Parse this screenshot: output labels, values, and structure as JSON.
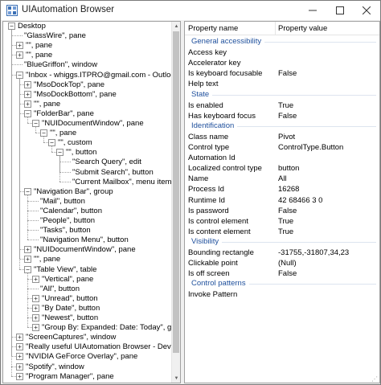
{
  "window": {
    "title": "UIAutomation Browser",
    "icon": "app-grid-icon"
  },
  "window_buttons": {
    "minimize": "minimize-icon",
    "maximize": "maximize-icon",
    "close": "close-icon"
  },
  "tree": {
    "nodes": [
      {
        "label": "Desktop",
        "depth": 0,
        "expander": "minus"
      },
      {
        "label": "\"GlassWire\", pane",
        "depth": 1,
        "expander": "none"
      },
      {
        "label": "\"\", pane",
        "depth": 1,
        "expander": "plus"
      },
      {
        "label": "\"\", pane",
        "depth": 1,
        "expander": "plus"
      },
      {
        "label": "\"BlueGriffon\", window",
        "depth": 1,
        "expander": "none"
      },
      {
        "label": "\"Inbox - whiggs.ITPRO@gmail.com - Outlook\", window",
        "depth": 1,
        "expander": "minus"
      },
      {
        "label": "\"MsoDockTop\", pane",
        "depth": 2,
        "expander": "plus"
      },
      {
        "label": "\"MsoDockBottom\", pane",
        "depth": 2,
        "expander": "plus"
      },
      {
        "label": "\"\", pane",
        "depth": 2,
        "expander": "plus"
      },
      {
        "label": "\"FolderBar\", pane",
        "depth": 2,
        "expander": "minus"
      },
      {
        "label": "\"NUIDocumentWindow\", pane",
        "depth": 3,
        "expander": "minus"
      },
      {
        "label": "\"\", pane",
        "depth": 4,
        "expander": "minus"
      },
      {
        "label": "\"\", custom",
        "depth": 5,
        "expander": "minus"
      },
      {
        "label": "\"\", button",
        "depth": 6,
        "expander": "minus"
      },
      {
        "label": "\"Search Query\", edit",
        "depth": 7,
        "expander": "none"
      },
      {
        "label": "\"Submit Search\", button",
        "depth": 7,
        "expander": "none"
      },
      {
        "label": "\"Current Mailbox\", menu item",
        "depth": 7,
        "expander": "none"
      },
      {
        "label": "\"Navigation Bar\", group",
        "depth": 2,
        "expander": "minus"
      },
      {
        "label": "\"Mail\", button",
        "depth": 3,
        "expander": "none"
      },
      {
        "label": "\"Calendar\", button",
        "depth": 3,
        "expander": "none"
      },
      {
        "label": "\"People\", button",
        "depth": 3,
        "expander": "none"
      },
      {
        "label": "\"Tasks\", button",
        "depth": 3,
        "expander": "none"
      },
      {
        "label": "\"Navigation Menu\", button",
        "depth": 3,
        "expander": "none"
      },
      {
        "label": "\"NUIDocumentWindow\", pane",
        "depth": 2,
        "expander": "plus"
      },
      {
        "label": "\"\", pane",
        "depth": 2,
        "expander": "plus"
      },
      {
        "label": "\"Table View\", table",
        "depth": 2,
        "expander": "minus"
      },
      {
        "label": "\"Vertical\", pane",
        "depth": 3,
        "expander": "plus"
      },
      {
        "label": "\"All\", button",
        "depth": 3,
        "expander": "none"
      },
      {
        "label": "\"Unread\", button",
        "depth": 3,
        "expander": "plus"
      },
      {
        "label": "\"By Date\", button",
        "depth": 3,
        "expander": "plus"
      },
      {
        "label": "\"Newest\", button",
        "depth": 3,
        "expander": "plus"
      },
      {
        "label": "\"Group By: Expanded: Date: Today\", group",
        "depth": 3,
        "expander": "plus"
      },
      {
        "label": "\"ScreenCaptures\", window",
        "depth": 1,
        "expander": "plus"
      },
      {
        "label": "\"Really useful UIAutomation Browser - Developer Commu",
        "depth": 1,
        "expander": "plus"
      },
      {
        "label": "\"NVIDIA GeForce Overlay\", pane",
        "depth": 1,
        "expander": "plus"
      },
      {
        "label": "\"Spotify\", window",
        "depth": 1,
        "expander": "plus"
      },
      {
        "label": "\"Program Manager\", pane",
        "depth": 1,
        "expander": "plus"
      }
    ]
  },
  "properties": {
    "col_name": "Property name",
    "col_value": "Property value",
    "groups": [
      {
        "title": "General accessibility",
        "rows": [
          {
            "name": "Access key",
            "value": ""
          },
          {
            "name": "Accelerator key",
            "value": ""
          },
          {
            "name": "Is keyboard focusable",
            "value": "False"
          },
          {
            "name": "Help text",
            "value": ""
          }
        ]
      },
      {
        "title": "State",
        "rows": [
          {
            "name": "Is enabled",
            "value": "True"
          },
          {
            "name": "Has keyboard focus",
            "value": "False"
          }
        ]
      },
      {
        "title": "Identification",
        "rows": [
          {
            "name": "Class name",
            "value": "Pivot"
          },
          {
            "name": "Control type",
            "value": "ControlType.Button"
          },
          {
            "name": "Automation Id",
            "value": ""
          },
          {
            "name": "Localized control type",
            "value": "button"
          },
          {
            "name": "Name",
            "value": "All"
          },
          {
            "name": "Process Id",
            "value": "16268"
          },
          {
            "name": "Runtime Id",
            "value": "42 68466 3 0"
          },
          {
            "name": "Is password",
            "value": "False"
          },
          {
            "name": "Is control element",
            "value": "True"
          },
          {
            "name": "Is content element",
            "value": "True"
          }
        ]
      },
      {
        "title": "Visibility",
        "rows": [
          {
            "name": "Bounding rectangle",
            "value": "-31755,-31807,34,23"
          },
          {
            "name": "Clickable point",
            "value": "(Null)"
          },
          {
            "name": "Is off screen",
            "value": "False"
          }
        ]
      },
      {
        "title": "Control patterns",
        "rows": [
          {
            "name": "Invoke Pattern",
            "value": ""
          }
        ]
      }
    ]
  }
}
